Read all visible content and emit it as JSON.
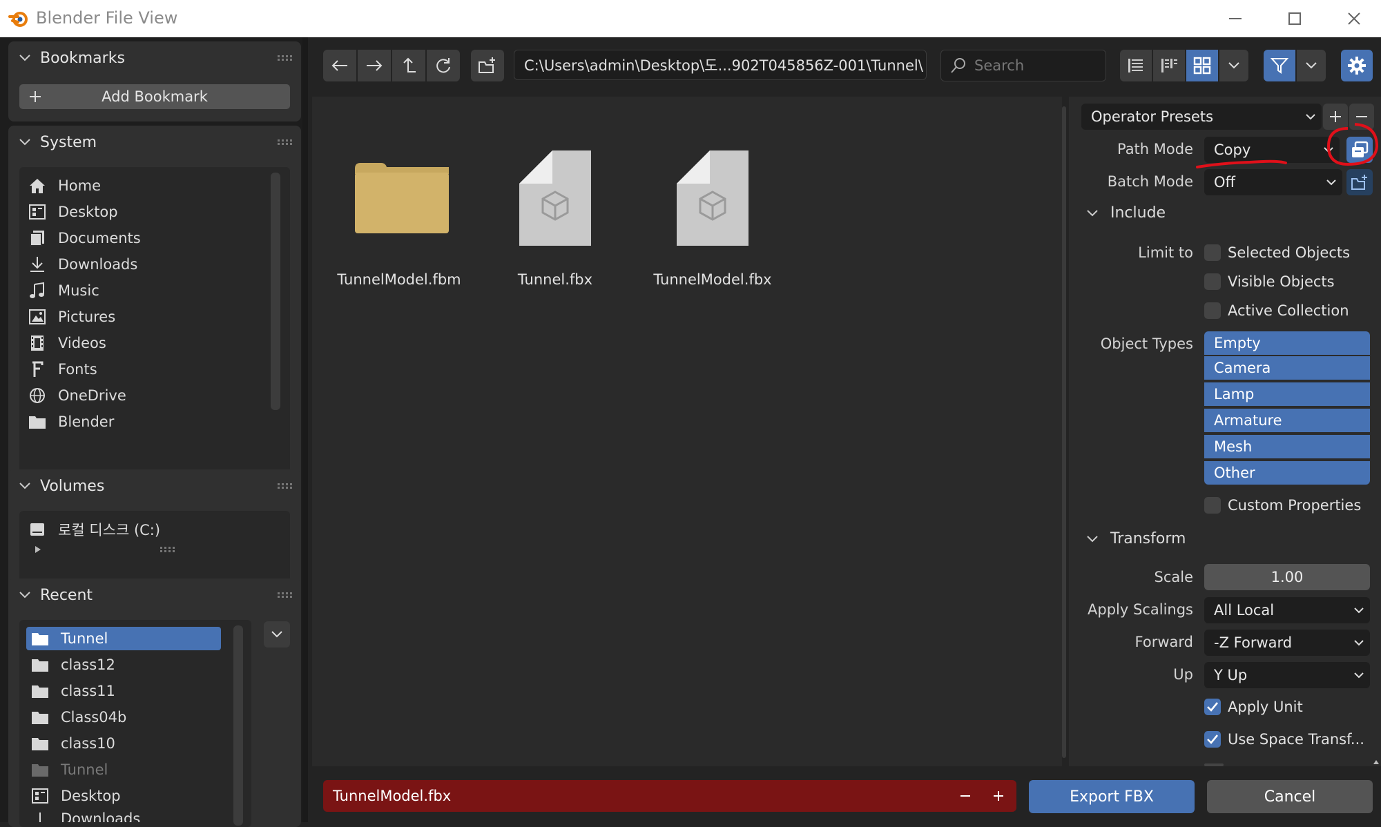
{
  "window": {
    "title": "Blender File View"
  },
  "sidebar": {
    "bookmarks": {
      "title": "Bookmarks",
      "add_label": "Add Bookmark"
    },
    "system": {
      "title": "System",
      "items": [
        {
          "label": "Home",
          "icon": "home-icon"
        },
        {
          "label": "Desktop",
          "icon": "desktop-icon"
        },
        {
          "label": "Documents",
          "icon": "documents-icon"
        },
        {
          "label": "Downloads",
          "icon": "download-icon"
        },
        {
          "label": "Music",
          "icon": "music-icon"
        },
        {
          "label": "Pictures",
          "icon": "picture-icon"
        },
        {
          "label": "Videos",
          "icon": "video-icon"
        },
        {
          "label": "Fonts",
          "icon": "font-icon"
        },
        {
          "label": "OneDrive",
          "icon": "globe-icon"
        },
        {
          "label": "Blender",
          "icon": "folder-icon"
        }
      ]
    },
    "volumes": {
      "title": "Volumes",
      "items": [
        {
          "label": "로컬 디스크 (C:)",
          "icon": "disk-icon"
        }
      ]
    },
    "recent": {
      "title": "Recent",
      "items": [
        {
          "label": "Tunnel",
          "icon": "folder-icon",
          "selected": true
        },
        {
          "label": "class12",
          "icon": "folder-icon"
        },
        {
          "label": "class11",
          "icon": "folder-icon"
        },
        {
          "label": "Class04b",
          "icon": "folder-icon"
        },
        {
          "label": "class10",
          "icon": "folder-icon"
        },
        {
          "label": "Tunnel",
          "icon": "folder-icon",
          "dim": true
        },
        {
          "label": "Desktop",
          "icon": "desktop-icon"
        },
        {
          "label": "Downloads",
          "icon": "download-icon"
        }
      ]
    }
  },
  "toolbar": {
    "path": "C:\\Users\\admin\\Desktop\\도...902T045856Z-001\\Tunnel\\",
    "search_placeholder": "Search"
  },
  "files": [
    {
      "name": "TunnelModel.fbm",
      "type": "folder"
    },
    {
      "name": "Tunnel.fbx",
      "type": "file"
    },
    {
      "name": "TunnelModel.fbx",
      "type": "file"
    }
  ],
  "operator": {
    "presets_label": "Operator Presets",
    "path_mode": {
      "label": "Path Mode",
      "value": "Copy"
    },
    "batch_mode": {
      "label": "Batch Mode",
      "value": "Off"
    },
    "include": {
      "title": "Include",
      "limit_to_label": "Limit to",
      "limits": [
        {
          "label": "Selected Objects",
          "checked": false
        },
        {
          "label": "Visible Objects",
          "checked": false
        },
        {
          "label": "Active Collection",
          "checked": false
        }
      ],
      "object_types_label": "Object Types",
      "object_types": [
        "Empty",
        "Camera",
        "Lamp",
        "Armature",
        "Mesh",
        "Other"
      ],
      "custom_props": {
        "label": "Custom Properties",
        "checked": false
      }
    },
    "transform": {
      "title": "Transform",
      "scale_label": "Scale",
      "scale_value": "1.00",
      "apply_scalings_label": "Apply Scalings",
      "apply_scalings_value": "All Local",
      "forward_label": "Forward",
      "forward_value": "-Z Forward",
      "up_label": "Up",
      "up_value": "Y Up",
      "apply_unit": {
        "label": "Apply Unit",
        "checked": true
      },
      "use_space": {
        "label": "Use Space Transf...",
        "checked": true
      }
    }
  },
  "bottom": {
    "filename": "TunnelModel.fbx",
    "export_label": "Export FBX",
    "cancel_label": "Cancel"
  },
  "colors": {
    "accent": "#4772b3",
    "filename_bg": "#7a1414",
    "annotation": "#e0101a",
    "folder": "#d2b36a"
  }
}
